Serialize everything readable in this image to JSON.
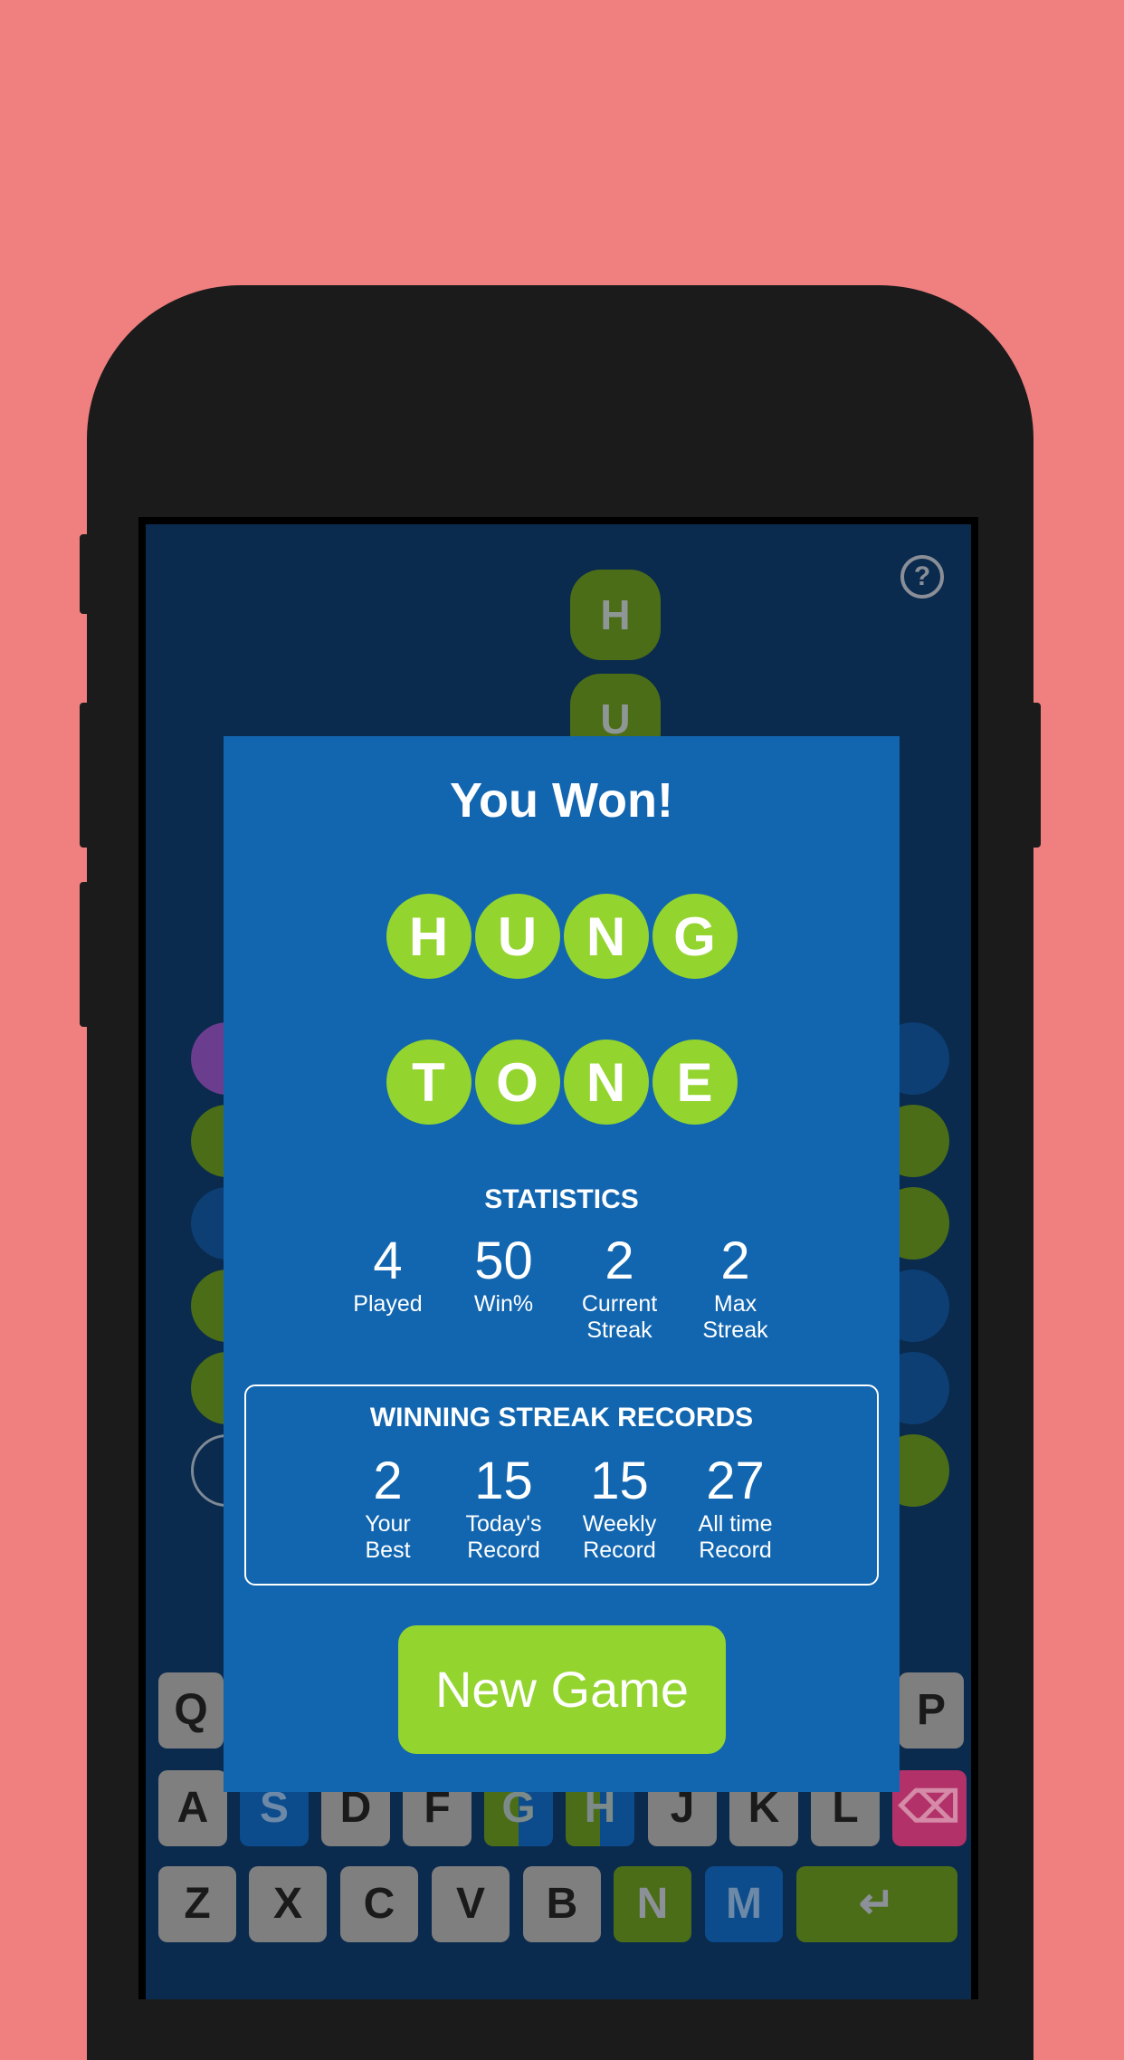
{
  "background_color": "#f07f7f",
  "help_icon": "question-circle-icon",
  "board": {
    "column_tiles": [
      "H",
      "U"
    ]
  },
  "modal": {
    "title": "You Won!",
    "words": [
      [
        "H",
        "U",
        "N",
        "G"
      ],
      [
        "T",
        "O",
        "N",
        "E"
      ]
    ],
    "statistics": {
      "title": "STATISTICS",
      "items": [
        {
          "value": "4",
          "label1": "Played",
          "label2": ""
        },
        {
          "value": "50",
          "label1": "Win%",
          "label2": ""
        },
        {
          "value": "2",
          "label1": "Current",
          "label2": "Streak"
        },
        {
          "value": "2",
          "label1": "Max",
          "label2": "Streak"
        }
      ]
    },
    "records": {
      "title": "WINNING STREAK RECORDS",
      "items": [
        {
          "value": "2",
          "label1": "Your",
          "label2": "Best"
        },
        {
          "value": "15",
          "label1": "Today's",
          "label2": "Record"
        },
        {
          "value": "15",
          "label1": "Weekly",
          "label2": "Record"
        },
        {
          "value": "27",
          "label1": "All time",
          "label2": "Record"
        }
      ]
    },
    "new_game_label": "New Game"
  },
  "keyboard": {
    "row1": [
      {
        "label": "Q",
        "state": "default"
      },
      {
        "label": "P",
        "state": "default"
      }
    ],
    "row2": [
      {
        "label": "A",
        "state": "default"
      },
      {
        "label": "S",
        "state": "blue"
      },
      {
        "label": "D",
        "state": "default"
      },
      {
        "label": "F",
        "state": "default"
      },
      {
        "label": "G",
        "state": "green-blue"
      },
      {
        "label": "H",
        "state": "green-blue"
      },
      {
        "label": "J",
        "state": "default"
      },
      {
        "label": "K",
        "state": "default"
      },
      {
        "label": "L",
        "state": "default"
      },
      {
        "label": "⌫",
        "state": "pink",
        "icon": "backspace-icon"
      }
    ],
    "row3": [
      {
        "label": "Z",
        "state": "default"
      },
      {
        "label": "X",
        "state": "default"
      },
      {
        "label": "C",
        "state": "default"
      },
      {
        "label": "V",
        "state": "default"
      },
      {
        "label": "B",
        "state": "default"
      },
      {
        "label": "N",
        "state": "green"
      },
      {
        "label": "M",
        "state": "blue"
      },
      {
        "label": "↵",
        "state": "green",
        "icon": "enter-icon"
      }
    ]
  }
}
